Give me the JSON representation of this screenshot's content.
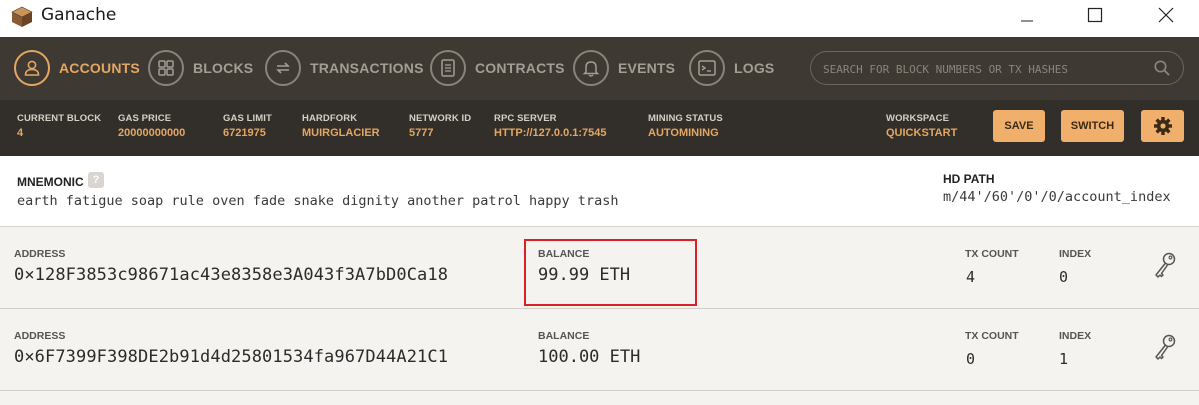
{
  "window": {
    "title": "Ganache"
  },
  "nav": {
    "items": [
      {
        "label": "ACCOUNTS",
        "icon": "account-icon",
        "active": true
      },
      {
        "label": "BLOCKS",
        "icon": "blocks-icon",
        "active": false
      },
      {
        "label": "TRANSACTIONS",
        "icon": "transactions-icon",
        "active": false
      },
      {
        "label": "CONTRACTS",
        "icon": "contracts-icon",
        "active": false
      },
      {
        "label": "EVENTS",
        "icon": "bell-icon",
        "active": false
      },
      {
        "label": "LOGS",
        "icon": "logs-icon",
        "active": false
      }
    ],
    "search_placeholder": "SEARCH FOR BLOCK NUMBERS OR TX HASHES"
  },
  "status": {
    "current_block": {
      "label": "CURRENT BLOCK",
      "value": "4"
    },
    "gas_price": {
      "label": "GAS PRICE",
      "value": "20000000000"
    },
    "gas_limit": {
      "label": "GAS LIMIT",
      "value": "6721975"
    },
    "hardfork": {
      "label": "HARDFORK",
      "value": "MUIRGLACIER"
    },
    "network_id": {
      "label": "NETWORK ID",
      "value": "5777"
    },
    "rpc_server": {
      "label": "RPC SERVER",
      "value": "HTTP://127.0.0.1:7545"
    },
    "mining_status": {
      "label": "MINING STATUS",
      "value": "AUTOMINING"
    },
    "workspace": {
      "label": "WORKSPACE",
      "value": "QUICKSTART"
    },
    "save_label": "SAVE",
    "switch_label": "SWITCH"
  },
  "mnemonic": {
    "label": "MNEMONIC",
    "help": "?",
    "words": "earth fatigue soap rule oven fade snake dignity another patrol happy trash",
    "hd_path_label": "HD PATH",
    "hd_path": "m/44'/60'/0'/0/account_index"
  },
  "accounts": [
    {
      "address_label": "ADDRESS",
      "address": "0×128F3853c98671ac43e8358e3A043f3A7bD0Ca18",
      "balance_label": "BALANCE",
      "balance": "99.99 ETH",
      "tx_count_label": "TX COUNT",
      "tx_count": "4",
      "index_label": "INDEX",
      "index": "0"
    },
    {
      "address_label": "ADDRESS",
      "address": "0×6F7399F398DE2b91d4d25801534fa967D44A21C1",
      "balance_label": "BALANCE",
      "balance": "100.00 ETH",
      "tx_count_label": "TX COUNT",
      "tx_count": "0",
      "index_label": "INDEX",
      "index": "1"
    }
  ],
  "colors": {
    "accent": "#e4a663",
    "nav_bg": "#3e3a33",
    "status_bg": "#322f2a",
    "button": "#f0b06b",
    "highlight": "#d8222a"
  }
}
